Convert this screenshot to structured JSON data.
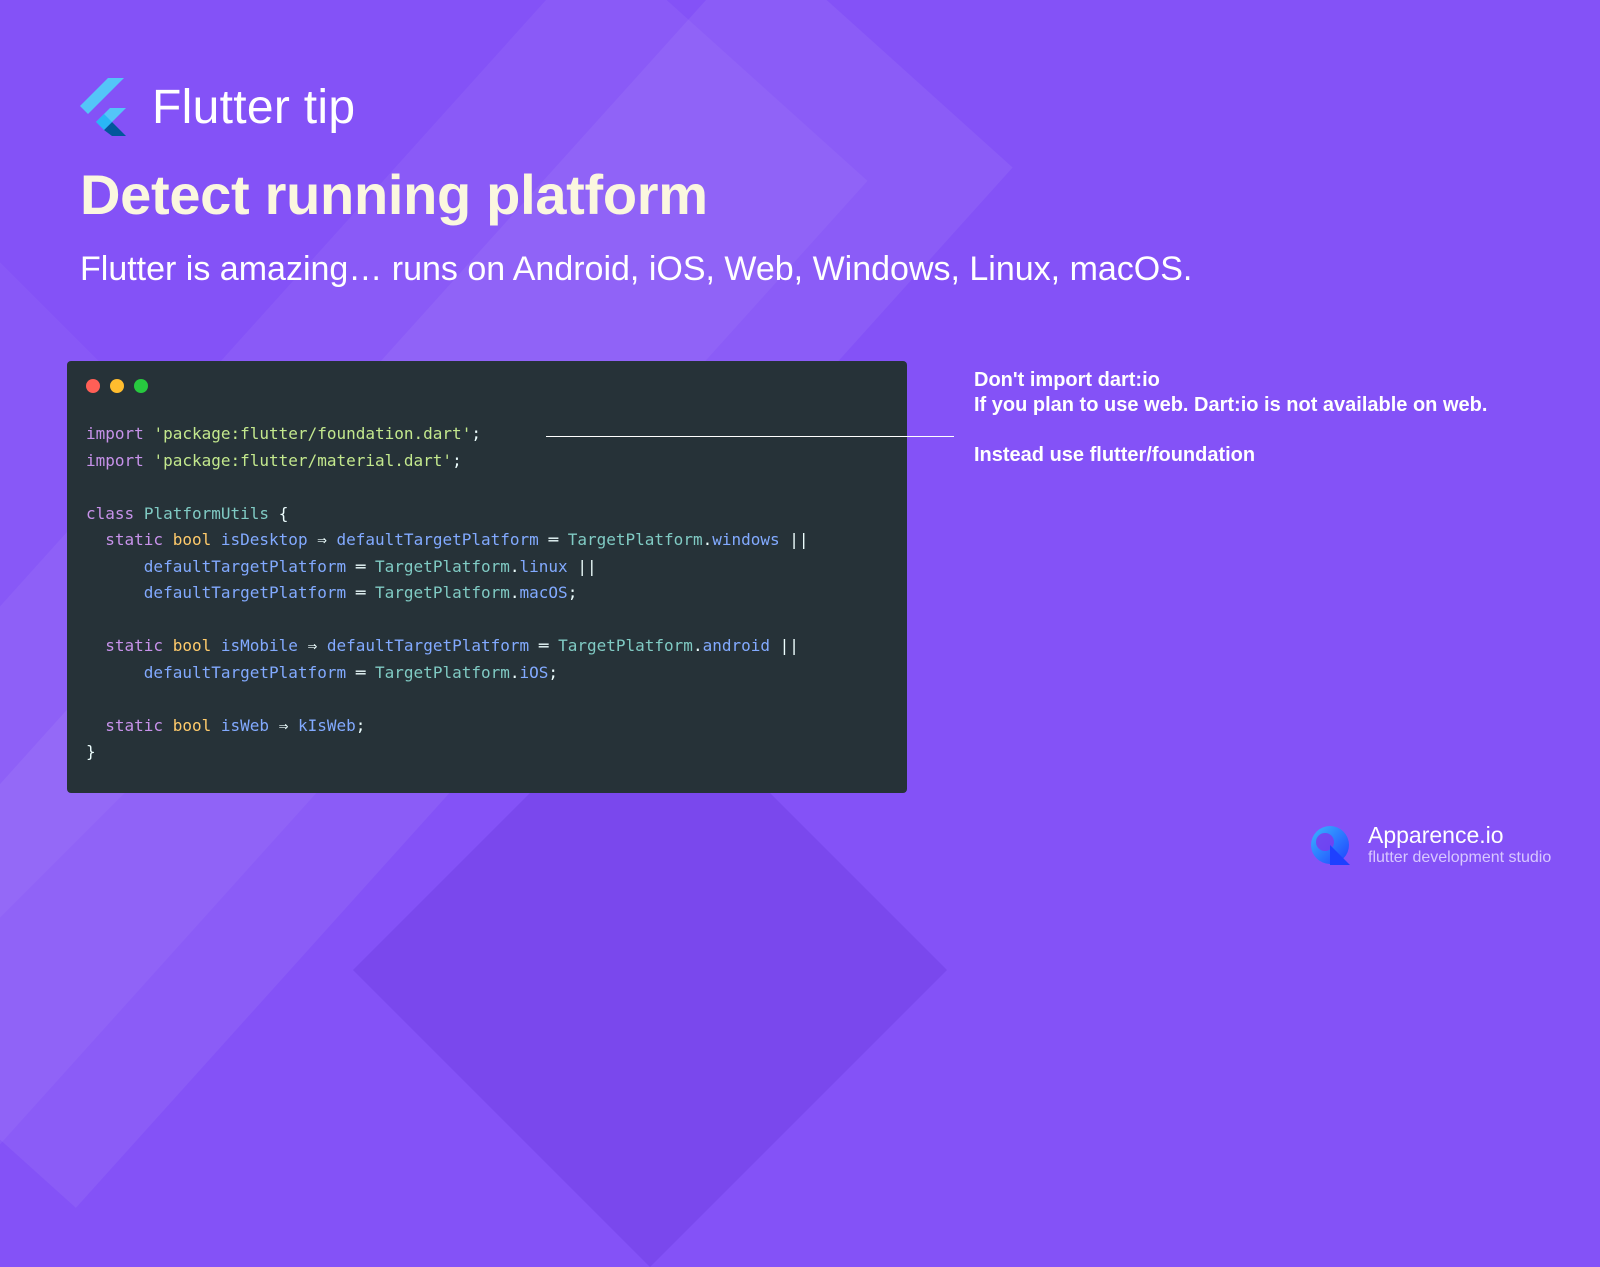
{
  "header": {
    "logo_icon": "flutter-logo-icon",
    "title": "Flutter tip"
  },
  "headline": "Detect running platform",
  "subline": "Flutter is amazing… runs on Android, iOS, Web, Windows, Linux, macOS.",
  "code_window": {
    "window_controls": [
      "close-dot",
      "minimize-dot",
      "maximize-dot"
    ],
    "colors": {
      "close": "#ff5f56",
      "minimize": "#ffbd2e",
      "maximize": "#27c93f",
      "background": "#263238"
    },
    "lines": [
      "import 'package:flutter/foundation.dart';",
      "import 'package:flutter/material.dart';",
      "",
      "class PlatformUtils {",
      "  static bool isDesktop ⇒ defaultTargetPlatform ═ TargetPlatform.windows ||",
      "      defaultTargetPlatform ═ TargetPlatform.linux ||",
      "      defaultTargetPlatform ═ TargetPlatform.macOS;",
      "",
      "  static bool isMobile ⇒ defaultTargetPlatform ═ TargetPlatform.android ||",
      "      defaultTargetPlatform ═ TargetPlatform.iOS;",
      "",
      "  static bool isWeb ⇒ kIsWeb;",
      "}"
    ]
  },
  "note": {
    "line1": "Don't import dart:io",
    "line2": "If you plan to use web. Dart:io is not available on web.",
    "line3": "Instead use flutter/foundation"
  },
  "footer": {
    "logo_icon": "apparence-logo-icon",
    "name": "Apparence.io",
    "tagline": "flutter development studio"
  },
  "colors": {
    "background": "#8452f7",
    "headline": "#fbf7df"
  }
}
